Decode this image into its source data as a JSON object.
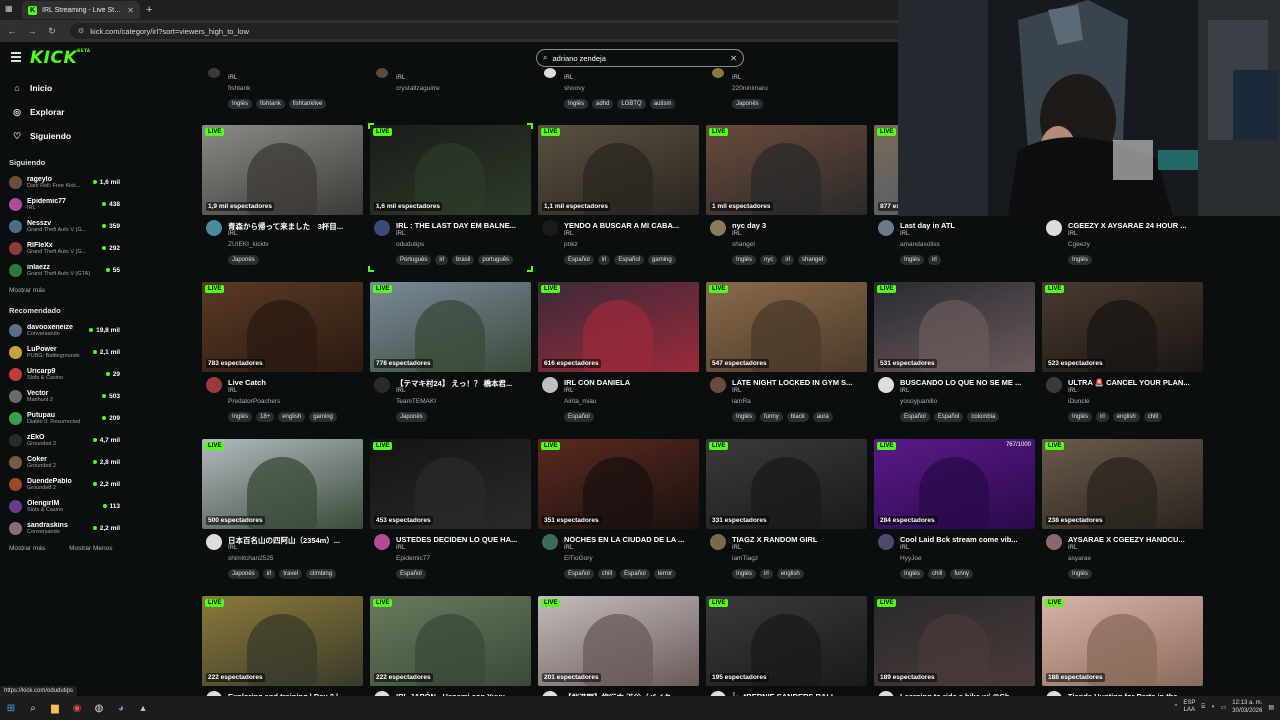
{
  "browser": {
    "tab_title": "IRL Streaming - Live Streams on...",
    "url": "kick.com/category/irl?sort=viewers_high_to_low",
    "status_url": "https://kick.com/odudutips"
  },
  "search": {
    "value": "adriano zendeja"
  },
  "logo": "KICK",
  "logo_badge": "BETA",
  "nav": [
    {
      "label": "Inicio",
      "icon": "home-icon"
    },
    {
      "label": "Explorar",
      "icon": "compass-icon"
    },
    {
      "label": "Siguiendo",
      "icon": "heart-icon"
    }
  ],
  "following": {
    "title": "Siguiendo",
    "channels": [
      {
        "name": "rageylo",
        "category": "Dark Roll: Free Kick...",
        "viewers": "1,6 mil",
        "color": "#6b4f3a"
      },
      {
        "name": "Epidemic77",
        "category": "IRL",
        "viewers": "438",
        "color": "#b04a9a"
      },
      {
        "name": "Nesszv",
        "category": "Grand Theft Auto V (G...",
        "viewers": "359",
        "color": "#4f6b8a"
      },
      {
        "name": "RIFIeXx",
        "category": "Grand Theft Auto V (G...",
        "viewers": "292",
        "color": "#8a3a3a"
      },
      {
        "name": "inlaezz",
        "category": "Grand Theft Auto V (GTA)",
        "viewers": "55",
        "color": "#2f7a3a"
      }
    ],
    "more": "Mostrar más"
  },
  "recommended": {
    "title": "Recomendado",
    "channels": [
      {
        "name": "davooxeneize",
        "category": "Conversando",
        "viewers": "19,8 mil",
        "color": "#5a6f8a"
      },
      {
        "name": "LuPower",
        "category": "PUBG: Battlegrounds",
        "viewers": "2,1 mil",
        "color": "#c9a23a"
      },
      {
        "name": "Uricarp9",
        "category": "Slots & Casino",
        "viewers": "29",
        "color": "#c23a3a"
      },
      {
        "name": "Vector",
        "category": "Manhunt 2",
        "viewers": "503",
        "color": "#6a6a6a"
      },
      {
        "name": "Putupau",
        "category": "Diablo II: Resurrected",
        "viewers": "209",
        "color": "#3aa04a"
      },
      {
        "name": "zEkO",
        "category": "Grounded 2",
        "viewers": "4,7 mil",
        "color": "#2a2a2a"
      },
      {
        "name": "Coker",
        "category": "Grounded 2",
        "viewers": "2,8 mil",
        "color": "#7a5a3a"
      },
      {
        "name": "DuendePablo",
        "category": "Grounded 2",
        "viewers": "2,2 mil",
        "color": "#9a4a2a"
      },
      {
        "name": "OlengirlM",
        "category": "Slots & Casino",
        "viewers": "113",
        "color": "#6a3a8a"
      },
      {
        "name": "sandraskins",
        "category": "Conversando",
        "viewers": "2,2 mil",
        "color": "#8a6a7a"
      }
    ],
    "more": "Mostrar más",
    "less": "Mostrar Menos"
  },
  "partial_row": [
    {
      "category": "IRL",
      "user": "fishtank",
      "tags": [
        "Inglés",
        "fishtank",
        "fishtanklive"
      ],
      "color": "#3a3a3a"
    },
    {
      "category": "IRL",
      "user": "crystallzaguirre",
      "tags": [],
      "color": "#5a4a3a"
    },
    {
      "category": "IRL",
      "user": "shoovy",
      "tags": [
        "Inglés",
        "adhd",
        "LGBTQ",
        "autism"
      ],
      "color": "#dddddd"
    },
    {
      "category": "IRL",
      "user": "220ninimaru",
      "tags": [
        "Japonés"
      ],
      "color": "#8a7a3a"
    }
  ],
  "live_label": "LIVE",
  "streams": [
    {
      "title": "青森から帰って来ました　3杯目...",
      "category": "IRL",
      "user": "ZUIEKI_kicktv",
      "viewers": "1,9 mil espectadores",
      "tags": [
        "Japonés"
      ],
      "thumb": "#8a8a86",
      "thumb2": "#3c3a36",
      "avatar": "#4a8a9a"
    },
    {
      "title": "IRL : THE LAST DAY EM BALNE...",
      "category": "IRL",
      "user": "odudutips",
      "viewers": "1,6 mil espectadores",
      "tags": [
        "Portugués",
        "irl",
        "brasil",
        "português"
      ],
      "thumb": "#1a1c1a",
      "thumb2": "#2e3a2a",
      "avatar": "#3a4a7a"
    },
    {
      "title": "YENDO A BUSCAR A MI CABA...",
      "category": "IRL",
      "user": "pnkz",
      "viewers": "1,1 mil espectadores",
      "tags": [
        "Español",
        "irl",
        "Español",
        "gaming"
      ],
      "thumb": "#5a5040",
      "thumb2": "#2a2620",
      "avatar": "#1a1a1a"
    },
    {
      "title": "nyc day 3",
      "category": "IRL",
      "user": "shangel",
      "viewers": "1 mil espectadores",
      "tags": [
        "Inglés",
        "nyc",
        "irl",
        "shangel"
      ],
      "thumb": "#6a4a3a",
      "thumb2": "#2a2a2a",
      "avatar": "#8a7a5a"
    },
    {
      "title": "Last day in ATL",
      "category": "IRL",
      "user": "amandasoliss",
      "viewers": "877 espectadores",
      "tags": [
        "Inglés",
        "irl"
      ],
      "thumb": "#7a6a5a",
      "thumb2": "#4a5a6a",
      "avatar": "#6a7a8a"
    },
    {
      "title": "CGEEZY X AYSARAE 24 HOUR ...",
      "category": "IRL",
      "user": "Cgeezy",
      "viewers": "",
      "tags": [
        "Inglés"
      ],
      "thumb": "#3a3a3a",
      "thumb2": "#1a1a1a",
      "avatar": "#dddddd"
    },
    {
      "title": "Live Catch",
      "category": "IRL",
      "user": "PredatorPoachers",
      "viewers": "783 espectadores",
      "tags": [
        "Inglés",
        "18+",
        "english",
        "gaming"
      ],
      "thumb": "#5a3a24",
      "thumb2": "#2a1a10",
      "avatar": "#9a3a3a"
    },
    {
      "title": "【テマキ村24】 えっ！？ 橋本君...",
      "category": "IRL",
      "user": "TeamTEMAKI",
      "viewers": "778 espectadores",
      "tags": [
        "Japonés"
      ],
      "thumb": "#7a8a9a",
      "thumb2": "#3a4a3a",
      "avatar": "#2a2a2a"
    },
    {
      "title": "IRL CON DANIELA",
      "category": "IRL",
      "user": "Airita_miau",
      "viewers": "616 espectadores",
      "tags": [
        "Español"
      ],
      "thumb": "#3a2a3a",
      "thumb2": "#9a2a3a",
      "avatar": "#bfbfbf"
    },
    {
      "title": "LATE NIGHT LOCKED IN GYM S...",
      "category": "IRL",
      "user": "iamRa",
      "viewers": "547 espectadores",
      "tags": [
        "Inglés",
        "funny",
        "black",
        "aura"
      ],
      "thumb": "#8a6a4a",
      "thumb2": "#4a3a2a",
      "avatar": "#6a4a3a"
    },
    {
      "title": "BUSCANDO LO QUE NO SE ME ...",
      "category": "IRL",
      "user": "yosoyjuanillo",
      "viewers": "531 espectadores",
      "tags": [
        "Español",
        "Español",
        "colombia"
      ],
      "thumb": "#2a2a34",
      "thumb2": "#6a5a5a",
      "avatar": "#dddddd"
    },
    {
      "title": "ULTRA 🚨 CANCEL YOUR PLAN...",
      "category": "IRL",
      "user": "iDuncle",
      "viewers": "523 espectadores",
      "tags": [
        "Inglés",
        "irl",
        "english",
        "chill"
      ],
      "thumb": "#4a3a30",
      "thumb2": "#1a1614",
      "avatar": "#3a3a3a"
    },
    {
      "title": "日本百名山の四阿山（2354m）...",
      "category": "IRL",
      "user": "shimitchan2525",
      "viewers": "500 espectadores",
      "tags": [
        "Japonés",
        "irl",
        "travel",
        "climbing"
      ],
      "thumb": "#b4bac0",
      "thumb2": "#3a4a3a",
      "avatar": "#dddddd"
    },
    {
      "title": "USTEDES DECIDEN LO QUE HA...",
      "category": "IRL",
      "user": "Epidemic77",
      "viewers": "453 espectadores",
      "tags": [
        "Español"
      ],
      "thumb": "#141414",
      "thumb2": "#2a2a2a",
      "avatar": "#b04a9a"
    },
    {
      "title": "NOCHES EN LA CIUDAD DE LA ...",
      "category": "IRL",
      "user": "ElTioGory",
      "viewers": "351 espectadores",
      "tags": [
        "Español",
        "chill",
        "Español",
        "terror"
      ],
      "thumb": "#5a2a1e",
      "thumb2": "#1a1010",
      "avatar": "#3a6a5a"
    },
    {
      "title": "TIAGZ X RANDOM GIRL",
      "category": "IRL",
      "user": "iamTiagz",
      "viewers": "331 espectadores",
      "tags": [
        "Inglés",
        "irl",
        "english"
      ],
      "thumb": "#3a3a3a",
      "thumb2": "#1a1a1a",
      "avatar": "#7a6a4a"
    },
    {
      "title": "Cool Laid Bck stream come vib...",
      "category": "IRL",
      "user": "HyyJoe",
      "viewers": "284 espectadores",
      "tags": [
        "Inglés",
        "chill",
        "funny"
      ],
      "thumb": "#5a1a8a",
      "thumb2": "#2a0a4a",
      "avatar": "#4a4a6a",
      "top": "767/1000"
    },
    {
      "title": "AYSARAE X CGEEZY HANDCU...",
      "category": "IRL",
      "user": "asyarae",
      "viewers": "238 espectadores",
      "tags": [
        "Inglés"
      ],
      "thumb": "#6a5a4a",
      "thumb2": "#2a2420",
      "avatar": "#8a6a6a"
    },
    {
      "title": "Exploring and training | Day 2 |...",
      "category": "",
      "user": "",
      "viewers": "222 espectadores",
      "tags": [],
      "thumb": "#8a7a3a",
      "thumb2": "#3a3a2a",
      "avatar": "#dddddd"
    },
    {
      "title": "IRL JAPÓN - Hanami con Yuyu...",
      "category": "",
      "user": "",
      "viewers": "222 espectadores",
      "tags": [],
      "thumb": "#6a7a5a",
      "thumb2": "#3a4a3a",
      "avatar": "#dddddd"
    },
    {
      "title": "【桜満開】旅行中 渋谷（バイク...",
      "category": "",
      "user": "",
      "viewers": "201 espectadores",
      "tags": [],
      "thumb": "#c4bcbc",
      "thumb2": "#6a5a5a",
      "avatar": "#dddddd"
    },
    {
      "title": "🗽 *BERNIE SANDERS RALL...",
      "category": "",
      "user": "",
      "viewers": "195 espectadores",
      "tags": [],
      "thumb": "#3a3a3a",
      "thumb2": "#1a1a1a",
      "avatar": "#dddddd"
    },
    {
      "title": "Learning to ride a bike w/ @Ch...",
      "category": "",
      "user": "",
      "viewers": "189 espectadores",
      "tags": [],
      "thumb": "#2a2a2a",
      "thumb2": "#4a3a3a",
      "avatar": "#dddddd"
    },
    {
      "title": "Tienda Hunting for Parts in the ...",
      "category": "",
      "user": "",
      "viewers": "188 espectadores",
      "tags": [],
      "thumb": "#d8b4a8",
      "thumb2": "#8a6a5a",
      "avatar": "#dddddd"
    }
  ],
  "taskbar": {
    "lang_top": "ESP",
    "lang_bottom": "LAA",
    "time": "12:13 a. m.",
    "date": "30/03/2026"
  }
}
